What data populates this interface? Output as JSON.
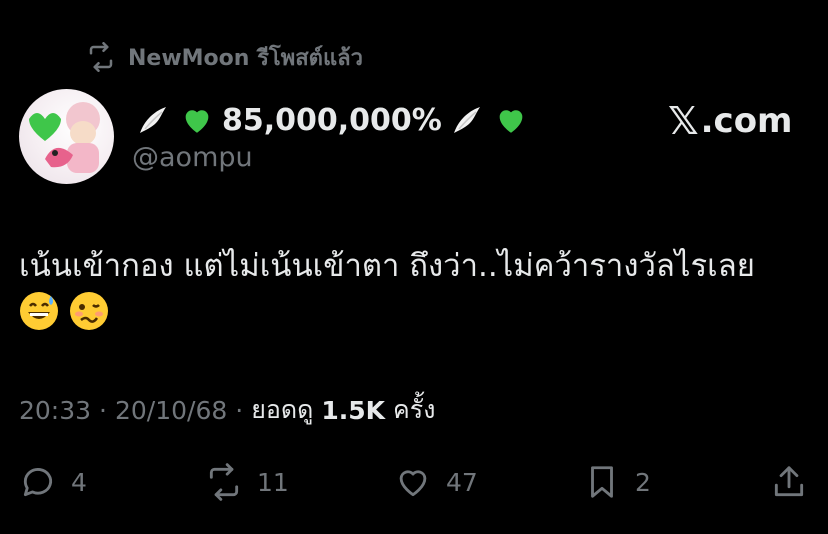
{
  "repost": {
    "label": "NewMoon รีโพสต์แล้ว"
  },
  "author": {
    "display_name_text": "85,000,000%",
    "handle": "@aompu",
    "name_emojis": [
      "wing-emoji",
      "green-heart-emoji",
      "wing-emoji",
      "green-heart-emoji"
    ]
  },
  "brand": {
    "x_glyph": "𝕏",
    "suffix": ".com"
  },
  "tweet": {
    "text": "เน้นเข้ากอง แต่ไม่เน้นเข้าตา ถึงว่า..ไม่คว้ารางวัลไรเลย",
    "emojis": [
      "grinning-sweat-emoji",
      "woozy-face-emoji"
    ]
  },
  "meta": {
    "time": "20:33",
    "sep1": "·",
    "date": "20/10/68",
    "sep2": "·",
    "views_prefix": "ยอดดู",
    "views": "1.5K",
    "views_suffix": "ครั้ง"
  },
  "actions": {
    "replies": "4",
    "reposts": "11",
    "likes": "47",
    "bookmarks": "2"
  },
  "colors": {
    "background": "#000000",
    "text": "#e7e9ea",
    "muted": "#71767b",
    "green_heart": "#3fc64a"
  }
}
